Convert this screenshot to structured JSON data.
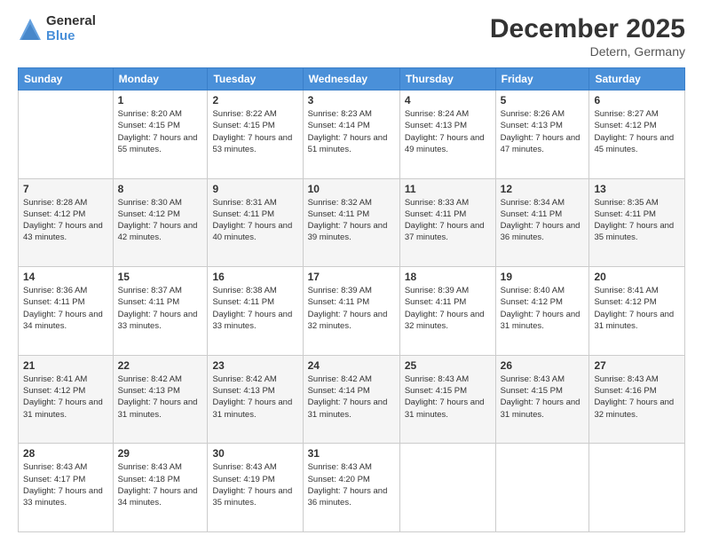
{
  "logo": {
    "general": "General",
    "blue": "Blue"
  },
  "header": {
    "month": "December 2025",
    "location": "Detern, Germany"
  },
  "weekdays": [
    "Sunday",
    "Monday",
    "Tuesday",
    "Wednesday",
    "Thursday",
    "Friday",
    "Saturday"
  ],
  "weeks": [
    [
      {
        "day": "",
        "sunrise": "",
        "sunset": "",
        "daylight": ""
      },
      {
        "day": "1",
        "sunrise": "Sunrise: 8:20 AM",
        "sunset": "Sunset: 4:15 PM",
        "daylight": "Daylight: 7 hours and 55 minutes."
      },
      {
        "day": "2",
        "sunrise": "Sunrise: 8:22 AM",
        "sunset": "Sunset: 4:15 PM",
        "daylight": "Daylight: 7 hours and 53 minutes."
      },
      {
        "day": "3",
        "sunrise": "Sunrise: 8:23 AM",
        "sunset": "Sunset: 4:14 PM",
        "daylight": "Daylight: 7 hours and 51 minutes."
      },
      {
        "day": "4",
        "sunrise": "Sunrise: 8:24 AM",
        "sunset": "Sunset: 4:13 PM",
        "daylight": "Daylight: 7 hours and 49 minutes."
      },
      {
        "day": "5",
        "sunrise": "Sunrise: 8:26 AM",
        "sunset": "Sunset: 4:13 PM",
        "daylight": "Daylight: 7 hours and 47 minutes."
      },
      {
        "day": "6",
        "sunrise": "Sunrise: 8:27 AM",
        "sunset": "Sunset: 4:12 PM",
        "daylight": "Daylight: 7 hours and 45 minutes."
      }
    ],
    [
      {
        "day": "7",
        "sunrise": "Sunrise: 8:28 AM",
        "sunset": "Sunset: 4:12 PM",
        "daylight": "Daylight: 7 hours and 43 minutes."
      },
      {
        "day": "8",
        "sunrise": "Sunrise: 8:30 AM",
        "sunset": "Sunset: 4:12 PM",
        "daylight": "Daylight: 7 hours and 42 minutes."
      },
      {
        "day": "9",
        "sunrise": "Sunrise: 8:31 AM",
        "sunset": "Sunset: 4:11 PM",
        "daylight": "Daylight: 7 hours and 40 minutes."
      },
      {
        "day": "10",
        "sunrise": "Sunrise: 8:32 AM",
        "sunset": "Sunset: 4:11 PM",
        "daylight": "Daylight: 7 hours and 39 minutes."
      },
      {
        "day": "11",
        "sunrise": "Sunrise: 8:33 AM",
        "sunset": "Sunset: 4:11 PM",
        "daylight": "Daylight: 7 hours and 37 minutes."
      },
      {
        "day": "12",
        "sunrise": "Sunrise: 8:34 AM",
        "sunset": "Sunset: 4:11 PM",
        "daylight": "Daylight: 7 hours and 36 minutes."
      },
      {
        "day": "13",
        "sunrise": "Sunrise: 8:35 AM",
        "sunset": "Sunset: 4:11 PM",
        "daylight": "Daylight: 7 hours and 35 minutes."
      }
    ],
    [
      {
        "day": "14",
        "sunrise": "Sunrise: 8:36 AM",
        "sunset": "Sunset: 4:11 PM",
        "daylight": "Daylight: 7 hours and 34 minutes."
      },
      {
        "day": "15",
        "sunrise": "Sunrise: 8:37 AM",
        "sunset": "Sunset: 4:11 PM",
        "daylight": "Daylight: 7 hours and 33 minutes."
      },
      {
        "day": "16",
        "sunrise": "Sunrise: 8:38 AM",
        "sunset": "Sunset: 4:11 PM",
        "daylight": "Daylight: 7 hours and 33 minutes."
      },
      {
        "day": "17",
        "sunrise": "Sunrise: 8:39 AM",
        "sunset": "Sunset: 4:11 PM",
        "daylight": "Daylight: 7 hours and 32 minutes."
      },
      {
        "day": "18",
        "sunrise": "Sunrise: 8:39 AM",
        "sunset": "Sunset: 4:11 PM",
        "daylight": "Daylight: 7 hours and 32 minutes."
      },
      {
        "day": "19",
        "sunrise": "Sunrise: 8:40 AM",
        "sunset": "Sunset: 4:12 PM",
        "daylight": "Daylight: 7 hours and 31 minutes."
      },
      {
        "day": "20",
        "sunrise": "Sunrise: 8:41 AM",
        "sunset": "Sunset: 4:12 PM",
        "daylight": "Daylight: 7 hours and 31 minutes."
      }
    ],
    [
      {
        "day": "21",
        "sunrise": "Sunrise: 8:41 AM",
        "sunset": "Sunset: 4:12 PM",
        "daylight": "Daylight: 7 hours and 31 minutes."
      },
      {
        "day": "22",
        "sunrise": "Sunrise: 8:42 AM",
        "sunset": "Sunset: 4:13 PM",
        "daylight": "Daylight: 7 hours and 31 minutes."
      },
      {
        "day": "23",
        "sunrise": "Sunrise: 8:42 AM",
        "sunset": "Sunset: 4:13 PM",
        "daylight": "Daylight: 7 hours and 31 minutes."
      },
      {
        "day": "24",
        "sunrise": "Sunrise: 8:42 AM",
        "sunset": "Sunset: 4:14 PM",
        "daylight": "Daylight: 7 hours and 31 minutes."
      },
      {
        "day": "25",
        "sunrise": "Sunrise: 8:43 AM",
        "sunset": "Sunset: 4:15 PM",
        "daylight": "Daylight: 7 hours and 31 minutes."
      },
      {
        "day": "26",
        "sunrise": "Sunrise: 8:43 AM",
        "sunset": "Sunset: 4:15 PM",
        "daylight": "Daylight: 7 hours and 31 minutes."
      },
      {
        "day": "27",
        "sunrise": "Sunrise: 8:43 AM",
        "sunset": "Sunset: 4:16 PM",
        "daylight": "Daylight: 7 hours and 32 minutes."
      }
    ],
    [
      {
        "day": "28",
        "sunrise": "Sunrise: 8:43 AM",
        "sunset": "Sunset: 4:17 PM",
        "daylight": "Daylight: 7 hours and 33 minutes."
      },
      {
        "day": "29",
        "sunrise": "Sunrise: 8:43 AM",
        "sunset": "Sunset: 4:18 PM",
        "daylight": "Daylight: 7 hours and 34 minutes."
      },
      {
        "day": "30",
        "sunrise": "Sunrise: 8:43 AM",
        "sunset": "Sunset: 4:19 PM",
        "daylight": "Daylight: 7 hours and 35 minutes."
      },
      {
        "day": "31",
        "sunrise": "Sunrise: 8:43 AM",
        "sunset": "Sunset: 4:20 PM",
        "daylight": "Daylight: 7 hours and 36 minutes."
      },
      {
        "day": "",
        "sunrise": "",
        "sunset": "",
        "daylight": ""
      },
      {
        "day": "",
        "sunrise": "",
        "sunset": "",
        "daylight": ""
      },
      {
        "day": "",
        "sunrise": "",
        "sunset": "",
        "daylight": ""
      }
    ]
  ]
}
